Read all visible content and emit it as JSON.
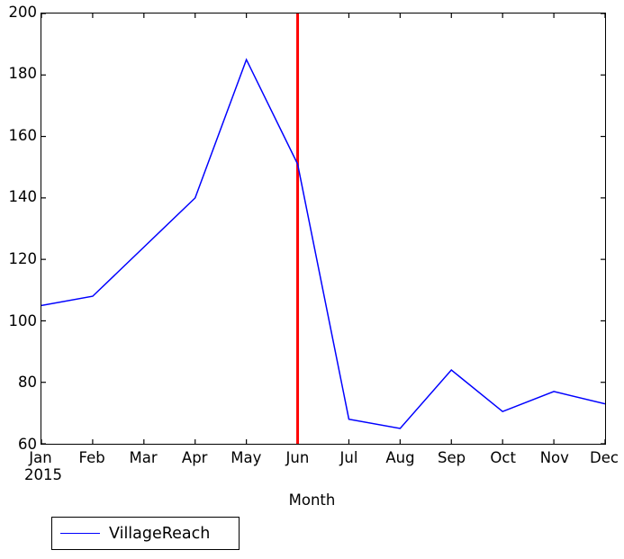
{
  "chart_data": {
    "type": "line",
    "title": "",
    "xlabel": "Month",
    "ylabel": "",
    "categories": [
      "Jan",
      "Feb",
      "Mar",
      "Apr",
      "May",
      "Jun",
      "Jul",
      "Aug",
      "Sep",
      "Oct",
      "Nov",
      "Dec"
    ],
    "x_sub_label": "2015",
    "series": [
      {
        "name": "VillageReach",
        "color": "#0000ff",
        "values": [
          105,
          108,
          124,
          140,
          185,
          151,
          68,
          65,
          84,
          70.5,
          77,
          73
        ]
      }
    ],
    "ylim": [
      60,
      200
    ],
    "yticks": [
      60,
      80,
      100,
      120,
      140,
      160,
      180,
      200
    ],
    "ytick_labels": [
      "60",
      "80",
      "100",
      "120",
      "140",
      "160",
      "180",
      "200"
    ],
    "xlim": [
      0,
      11
    ],
    "grid": false,
    "legend_position": "below-left",
    "annotations": [
      {
        "type": "vertical-line",
        "name": "event-marker",
        "x_category": "Jun",
        "x_value": 5,
        "color": "#ff0000",
        "linewidth": 3
      }
    ]
  },
  "legend": {
    "entries": [
      {
        "label": "VillageReach",
        "color": "#0000ff"
      }
    ]
  },
  "axis": {
    "x_title": "Month",
    "y_title": ""
  }
}
